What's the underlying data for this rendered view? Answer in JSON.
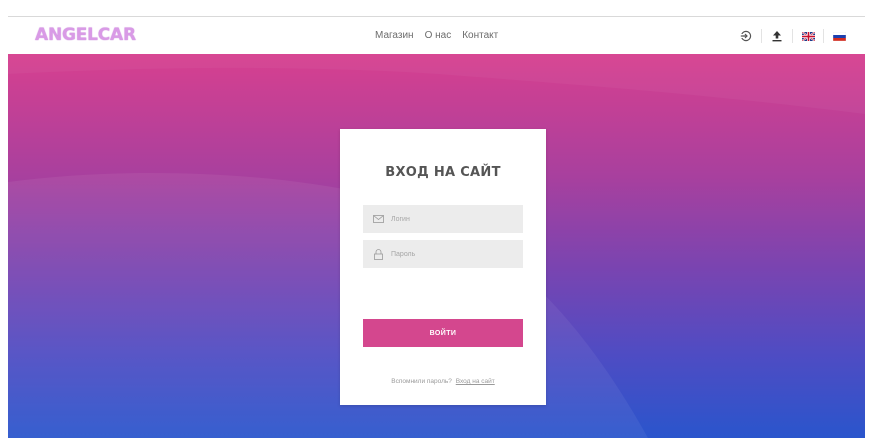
{
  "header": {
    "logo": "ANGELCAR",
    "nav": [
      "Магазин",
      "О нас",
      "Контакт"
    ]
  },
  "icons": {
    "login": "login-icon",
    "upload": "upload-icon",
    "lang_en": "uk-flag-icon",
    "lang_ru": "russia-flag-icon"
  },
  "colors": {
    "logo": "#d99ae6",
    "gradient_top": "#d7408f",
    "gradient_bottom": "#2a55cc",
    "button": "#d4478e",
    "field_bg": "#ececec"
  },
  "login_form": {
    "title": "ВХОД НА САЙТ",
    "login_placeholder": "Логин",
    "password_placeholder": "Пароль",
    "submit_label": "ВОЙТИ",
    "remember_text": "Вспомнили пароль?",
    "remember_link": "Вход на сайт"
  }
}
